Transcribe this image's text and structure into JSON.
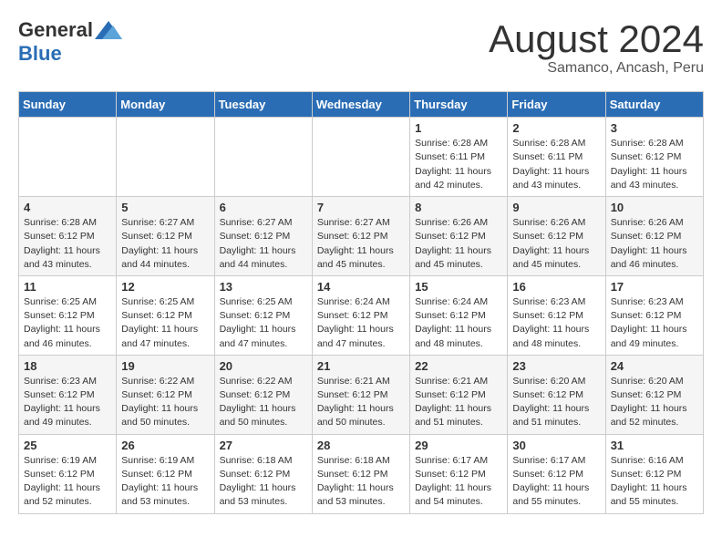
{
  "logo": {
    "general": "General",
    "blue": "Blue"
  },
  "title": {
    "month_year": "August 2024",
    "location": "Samanco, Ancash, Peru"
  },
  "weekdays": [
    "Sunday",
    "Monday",
    "Tuesday",
    "Wednesday",
    "Thursday",
    "Friday",
    "Saturday"
  ],
  "weeks": [
    [
      {
        "day": "",
        "info": ""
      },
      {
        "day": "",
        "info": ""
      },
      {
        "day": "",
        "info": ""
      },
      {
        "day": "",
        "info": ""
      },
      {
        "day": "1",
        "info": "Sunrise: 6:28 AM\nSunset: 6:11 PM\nDaylight: 11 hours and 42 minutes."
      },
      {
        "day": "2",
        "info": "Sunrise: 6:28 AM\nSunset: 6:11 PM\nDaylight: 11 hours and 43 minutes."
      },
      {
        "day": "3",
        "info": "Sunrise: 6:28 AM\nSunset: 6:12 PM\nDaylight: 11 hours and 43 minutes."
      }
    ],
    [
      {
        "day": "4",
        "info": "Sunrise: 6:28 AM\nSunset: 6:12 PM\nDaylight: 11 hours and 43 minutes."
      },
      {
        "day": "5",
        "info": "Sunrise: 6:27 AM\nSunset: 6:12 PM\nDaylight: 11 hours and 44 minutes."
      },
      {
        "day": "6",
        "info": "Sunrise: 6:27 AM\nSunset: 6:12 PM\nDaylight: 11 hours and 44 minutes."
      },
      {
        "day": "7",
        "info": "Sunrise: 6:27 AM\nSunset: 6:12 PM\nDaylight: 11 hours and 45 minutes."
      },
      {
        "day": "8",
        "info": "Sunrise: 6:26 AM\nSunset: 6:12 PM\nDaylight: 11 hours and 45 minutes."
      },
      {
        "day": "9",
        "info": "Sunrise: 6:26 AM\nSunset: 6:12 PM\nDaylight: 11 hours and 45 minutes."
      },
      {
        "day": "10",
        "info": "Sunrise: 6:26 AM\nSunset: 6:12 PM\nDaylight: 11 hours and 46 minutes."
      }
    ],
    [
      {
        "day": "11",
        "info": "Sunrise: 6:25 AM\nSunset: 6:12 PM\nDaylight: 11 hours and 46 minutes."
      },
      {
        "day": "12",
        "info": "Sunrise: 6:25 AM\nSunset: 6:12 PM\nDaylight: 11 hours and 47 minutes."
      },
      {
        "day": "13",
        "info": "Sunrise: 6:25 AM\nSunset: 6:12 PM\nDaylight: 11 hours and 47 minutes."
      },
      {
        "day": "14",
        "info": "Sunrise: 6:24 AM\nSunset: 6:12 PM\nDaylight: 11 hours and 47 minutes."
      },
      {
        "day": "15",
        "info": "Sunrise: 6:24 AM\nSunset: 6:12 PM\nDaylight: 11 hours and 48 minutes."
      },
      {
        "day": "16",
        "info": "Sunrise: 6:23 AM\nSunset: 6:12 PM\nDaylight: 11 hours and 48 minutes."
      },
      {
        "day": "17",
        "info": "Sunrise: 6:23 AM\nSunset: 6:12 PM\nDaylight: 11 hours and 49 minutes."
      }
    ],
    [
      {
        "day": "18",
        "info": "Sunrise: 6:23 AM\nSunset: 6:12 PM\nDaylight: 11 hours and 49 minutes."
      },
      {
        "day": "19",
        "info": "Sunrise: 6:22 AM\nSunset: 6:12 PM\nDaylight: 11 hours and 50 minutes."
      },
      {
        "day": "20",
        "info": "Sunrise: 6:22 AM\nSunset: 6:12 PM\nDaylight: 11 hours and 50 minutes."
      },
      {
        "day": "21",
        "info": "Sunrise: 6:21 AM\nSunset: 6:12 PM\nDaylight: 11 hours and 50 minutes."
      },
      {
        "day": "22",
        "info": "Sunrise: 6:21 AM\nSunset: 6:12 PM\nDaylight: 11 hours and 51 minutes."
      },
      {
        "day": "23",
        "info": "Sunrise: 6:20 AM\nSunset: 6:12 PM\nDaylight: 11 hours and 51 minutes."
      },
      {
        "day": "24",
        "info": "Sunrise: 6:20 AM\nSunset: 6:12 PM\nDaylight: 11 hours and 52 minutes."
      }
    ],
    [
      {
        "day": "25",
        "info": "Sunrise: 6:19 AM\nSunset: 6:12 PM\nDaylight: 11 hours and 52 minutes."
      },
      {
        "day": "26",
        "info": "Sunrise: 6:19 AM\nSunset: 6:12 PM\nDaylight: 11 hours and 53 minutes."
      },
      {
        "day": "27",
        "info": "Sunrise: 6:18 AM\nSunset: 6:12 PM\nDaylight: 11 hours and 53 minutes."
      },
      {
        "day": "28",
        "info": "Sunrise: 6:18 AM\nSunset: 6:12 PM\nDaylight: 11 hours and 53 minutes."
      },
      {
        "day": "29",
        "info": "Sunrise: 6:17 AM\nSunset: 6:12 PM\nDaylight: 11 hours and 54 minutes."
      },
      {
        "day": "30",
        "info": "Sunrise: 6:17 AM\nSunset: 6:12 PM\nDaylight: 11 hours and 55 minutes."
      },
      {
        "day": "31",
        "info": "Sunrise: 6:16 AM\nSunset: 6:12 PM\nDaylight: 11 hours and 55 minutes."
      }
    ]
  ]
}
